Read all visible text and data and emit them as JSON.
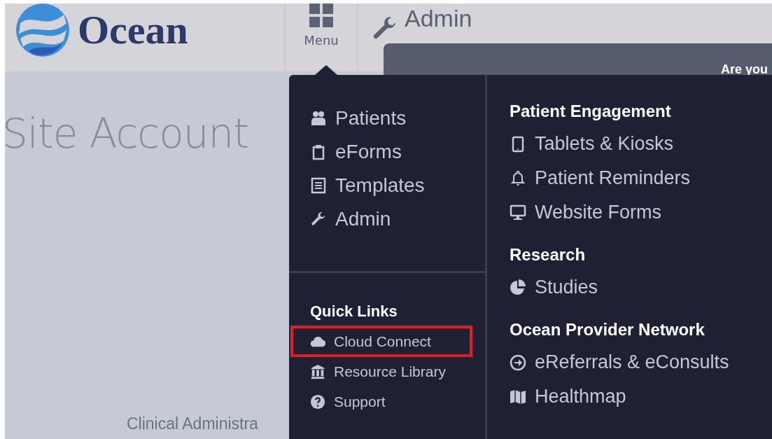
{
  "logo": {
    "text": "Ocean"
  },
  "menu_button": {
    "label": "Menu",
    "expanded": true
  },
  "page_header": {
    "title": "Admin"
  },
  "dialog": {
    "heading": "Are you"
  },
  "page": {
    "title": "Site Account",
    "footer": "Clinical Administra"
  },
  "menu": {
    "main_items": [
      {
        "label": "Patients",
        "kind": "users"
      },
      {
        "label": "eForms",
        "kind": "clipboard"
      },
      {
        "label": "Templates",
        "kind": "document"
      },
      {
        "label": "Admin",
        "kind": "wrench"
      }
    ],
    "quick_links": {
      "heading": "Quick Links",
      "items": [
        {
          "label": "Cloud Connect",
          "kind": "cloud",
          "highlighted": true
        },
        {
          "label": "Resource Library",
          "kind": "bank",
          "highlighted": false
        },
        {
          "label": "Support",
          "kind": "help",
          "highlighted": false
        }
      ]
    },
    "sections": [
      {
        "heading": "Patient Engagement",
        "items": [
          {
            "label": "Tablets & Kiosks",
            "kind": "tablet"
          },
          {
            "label": "Patient Reminders",
            "kind": "bell"
          },
          {
            "label": "Website Forms",
            "kind": "monitor"
          }
        ]
      },
      {
        "heading": "Research",
        "items": [
          {
            "label": "Studies",
            "kind": "pie"
          }
        ]
      },
      {
        "heading": "Ocean Provider Network",
        "items": [
          {
            "label": "eReferrals & eConsults",
            "kind": "arrow-circle"
          },
          {
            "label": "Healthmap",
            "kind": "map"
          }
        ]
      }
    ]
  }
}
